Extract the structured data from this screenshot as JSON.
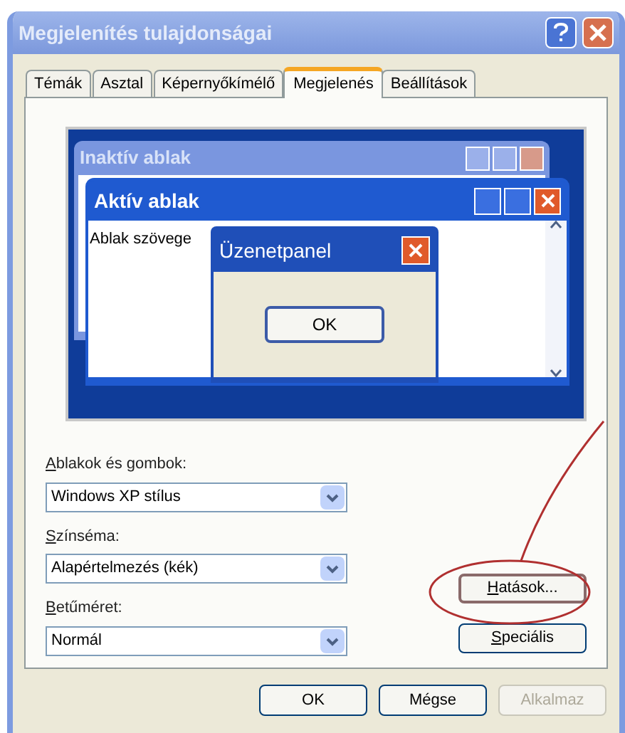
{
  "window": {
    "title": "Megjelenítés tulajdonságai"
  },
  "tabs": [
    {
      "label": "Témák",
      "selected": false
    },
    {
      "label": "Asztal",
      "selected": false
    },
    {
      "label": "Képernyőkímélő",
      "selected": false
    },
    {
      "label": "Megjelenés",
      "selected": true
    },
    {
      "label": "Beállítások",
      "selected": false
    }
  ],
  "preview": {
    "inactive_window": {
      "title": "Inaktív ablak"
    },
    "active_window": {
      "title": "Aktív ablak",
      "text": "Ablak szövege"
    },
    "message_box": {
      "title": "Üzenetpanel",
      "button": "OK"
    }
  },
  "fields": [
    {
      "label": "Ablakok és gombok:",
      "value": "Windows XP stílus"
    },
    {
      "label": "Színséma:",
      "value": "Alapértelmezés (kék)"
    },
    {
      "label": "Betűméret:",
      "value": "Normál"
    }
  ],
  "side_buttons": [
    {
      "label": "Hatások...",
      "highlighted": true
    },
    {
      "label": "Speciális",
      "highlighted": false
    }
  ],
  "buttons": [
    {
      "label": "OK",
      "disabled": false
    },
    {
      "label": "Mégse",
      "disabled": false
    },
    {
      "label": "Alkalmaz",
      "disabled": true
    }
  ]
}
